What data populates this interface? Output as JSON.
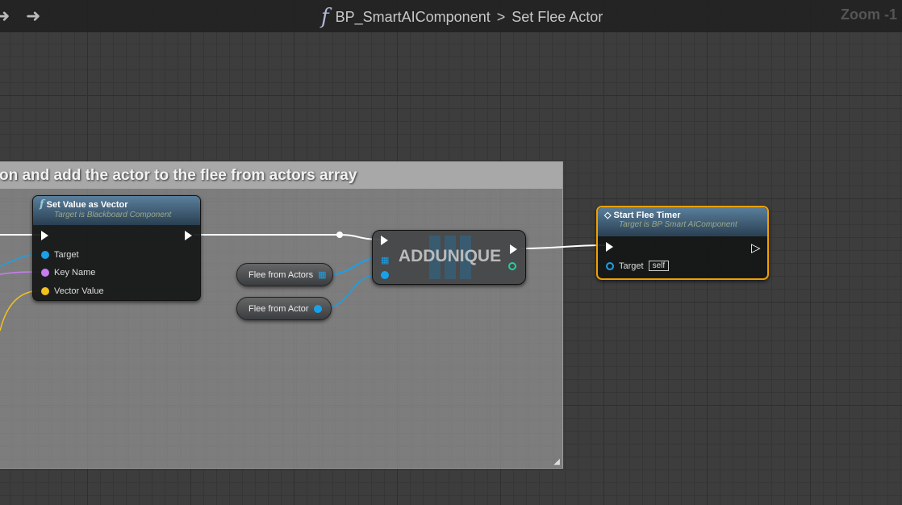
{
  "topbar": {
    "breadcrumb_blueprint": "BP_SmartAIComponent",
    "separator": ">",
    "breadcrumb_function": "Set Flee Actor",
    "zoom": "Zoom -1"
  },
  "comment": {
    "text": "on and add the actor to the flee from actors array"
  },
  "set_value_node": {
    "title": "Set Value as Vector",
    "subtitle": "Target is Blackboard Component",
    "pins": [
      "Target",
      "Key Name",
      "Vector Value"
    ]
  },
  "var_actors": {
    "label": "Flee from Actors"
  },
  "var_actor": {
    "label": "Flee from Actor"
  },
  "addunique_node": {
    "title": "ADDUNIQUE"
  },
  "start_timer_node": {
    "title": "Start Flee Timer",
    "subtitle": "Target is BP Smart AIComponent",
    "target_label": "Target",
    "target_value": "self"
  },
  "colors": {
    "object": "#1aa0e8",
    "name": "#c77ef0",
    "vector": "#f2c21c",
    "selected": "#f0a000"
  }
}
